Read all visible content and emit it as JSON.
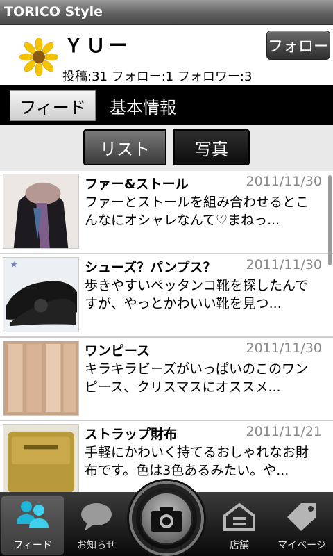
{
  "app": {
    "title": "TORICO Style"
  },
  "profile": {
    "name": "ＹＵー",
    "stats": "投稿:31  フォロー:1  フォロワー:3",
    "follow_label": "フォロー"
  },
  "tabs": {
    "feed": "フィード",
    "info": "基本情報"
  },
  "view_toggle": {
    "list": "リスト",
    "photo": "写真"
  },
  "posts": [
    {
      "title": "ファー&ストール",
      "date": "2011/11/30",
      "body": "ファーとストールを組み合わせるとこんなにオシャレなんて♡まねっ..."
    },
    {
      "title": "シューズ？パンプス？",
      "date": "2011/11/30",
      "body": "歩きやすいペッタンコ靴を探したんですが、やっとかわいい靴を見つ..."
    },
    {
      "title": "ワンピース",
      "date": "2011/11/30",
      "body": "キラキラビーズがいっぱいのこのワンピース、クリスマスにオススメ..."
    },
    {
      "title": "ストラップ財布",
      "date": "2011/11/21",
      "body": "手軽にかわいく持てるおしゃれなお財布です。色は3色あるみたい。や..."
    }
  ],
  "nav": {
    "feed": "フィード",
    "notice": "お知らせ",
    "store": "店舗",
    "mypage": "マイページ"
  },
  "icons": {
    "avatar": "sunflower-icon",
    "nav_feed": "people-icon",
    "nav_notice": "speech-bubble-icon",
    "nav_camera": "camera-icon",
    "nav_store": "store-icon",
    "nav_mypage": "tag-icon"
  }
}
